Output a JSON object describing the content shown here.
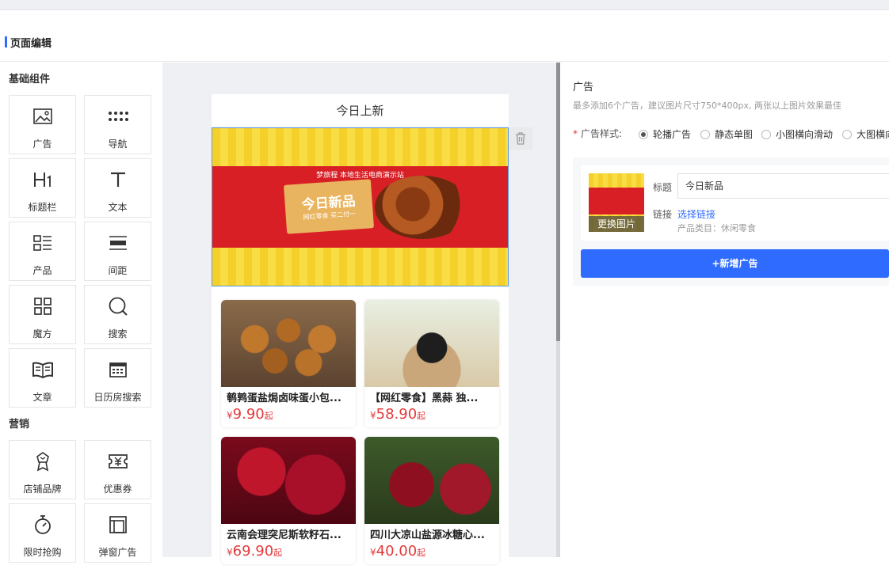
{
  "header": {
    "title": "页面编辑"
  },
  "components": {
    "basic_title": "基础组件",
    "basic": [
      {
        "label": "广告",
        "icon": "image-icon"
      },
      {
        "label": "导航",
        "icon": "dots-grid-icon"
      },
      {
        "label": "标题栏",
        "icon": "heading-icon"
      },
      {
        "label": "文本",
        "icon": "text-icon"
      },
      {
        "label": "产品",
        "icon": "product-list-icon"
      },
      {
        "label": "间距",
        "icon": "spacing-icon"
      },
      {
        "label": "魔方",
        "icon": "cube-grid-icon"
      },
      {
        "label": "搜索",
        "icon": "search-icon"
      },
      {
        "label": "文章",
        "icon": "book-icon"
      },
      {
        "label": "日历房搜索",
        "icon": "calendar-icon"
      }
    ],
    "marketing_title": "营销",
    "marketing": [
      {
        "label": "店铺品牌",
        "icon": "shop-brand-icon"
      },
      {
        "label": "优惠券",
        "icon": "coupon-icon"
      },
      {
        "label": "限时抢购",
        "icon": "stopwatch-icon"
      },
      {
        "label": "弹窗广告",
        "icon": "popup-icon"
      }
    ]
  },
  "preview": {
    "phone_title": "今日上新",
    "banner": {
      "headline": "梦旅程 本地生活电商演示站",
      "main": "今日新品",
      "sub": "网红零食 买二付一"
    },
    "products": [
      {
        "name": "鹌鹑蛋盐焗卤味蛋小包...",
        "currency": "¥",
        "price": "9.90",
        "suffix": "起"
      },
      {
        "name": "【网红零食】黑蒜 独...",
        "currency": "¥",
        "price": "58.90",
        "suffix": "起"
      },
      {
        "name": "云南会理突尼斯软籽石...",
        "currency": "¥",
        "price": "69.90",
        "suffix": "起"
      },
      {
        "name": "四川大凉山盐源冰糖心...",
        "currency": "¥",
        "price": "40.00",
        "suffix": "起"
      }
    ]
  },
  "settings": {
    "title": "广告",
    "tip": "最多添加6个广告，建议图片尺寸750*400px, 两张以上图片效果最佳",
    "style_label": "广告样式:",
    "style_required": "*",
    "style_options": [
      "轮播广告",
      "静态单图",
      "小图横向滑动",
      "大图横向滑动"
    ],
    "style_selected": 0,
    "ad": {
      "change_image": "更换图片",
      "title_label": "标题",
      "title_value": "今日新品",
      "link_label": "链接",
      "link_text": "选择链接",
      "category": "产品类目：休闲零食"
    },
    "add_button": "+新增广告"
  },
  "colors": {
    "accent": "#2f6bff",
    "price": "#e4393c"
  }
}
